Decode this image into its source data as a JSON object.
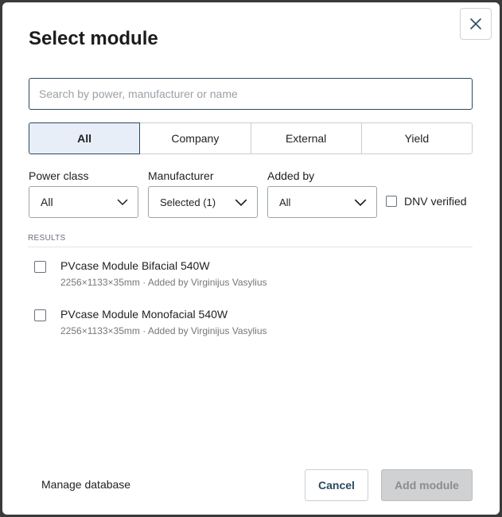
{
  "modal": {
    "title": "Select module",
    "close_icon": "close-icon"
  },
  "search": {
    "placeholder": "Search by power, manufacturer or name",
    "value": ""
  },
  "tabs": [
    {
      "label": "All",
      "active": true
    },
    {
      "label": "Company",
      "active": false
    },
    {
      "label": "External",
      "active": false
    },
    {
      "label": "Yield",
      "active": false
    }
  ],
  "filters": {
    "power_class": {
      "label": "Power class",
      "value": "All"
    },
    "manufacturer": {
      "label": "Manufacturer",
      "value": "Selected (1)"
    },
    "added_by": {
      "label": "Added by",
      "value": "All"
    },
    "dnv_verified": {
      "label": "DNV verified",
      "checked": false
    }
  },
  "results": {
    "label": "RESULTS",
    "items": [
      {
        "name": "PVcase Module Bifacial 540W",
        "meta": "2256×1133×35mm · Added by Virginijus Vasylius",
        "checked": false
      },
      {
        "name": "PVcase Module Monofacial 540W",
        "meta": "2256×1133×35mm · Added by Virginijus Vasylius",
        "checked": false
      }
    ]
  },
  "footer": {
    "manage_label": "Manage database",
    "cancel_label": "Cancel",
    "add_label": "Add module",
    "add_disabled": true
  },
  "colors": {
    "accent": "#2b4a5f",
    "active_tab_bg": "#e7eef8",
    "disabled_btn_bg": "#cfd1d3"
  }
}
